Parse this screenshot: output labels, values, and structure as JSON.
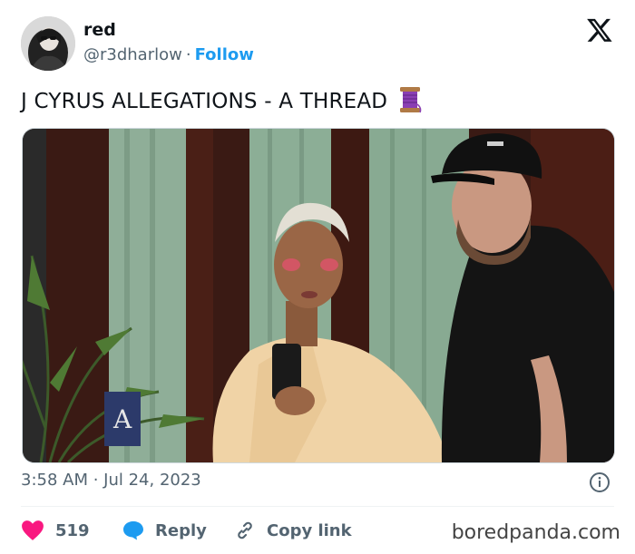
{
  "author": {
    "name": "red",
    "handle": "@r3dharlow",
    "separator": "·",
    "follow_label": "Follow",
    "avatar_icon": "profile-photo"
  },
  "tweet": {
    "text": "J CYRUS ALLEGATIONS - A THREAD",
    "emoji_icon": "spool-of-thread-icon",
    "timestamp": "3:58 AM · Jul 24, 2023"
  },
  "actions": {
    "likes_count": "519",
    "reply_label": "Reply",
    "copy_link_label": "Copy link"
  },
  "watermark": "boredpanda.com",
  "colors": {
    "accent": "#1d9bf0",
    "like": "#f91880",
    "secondary_text": "#536471",
    "primary_text": "#0f1419"
  }
}
